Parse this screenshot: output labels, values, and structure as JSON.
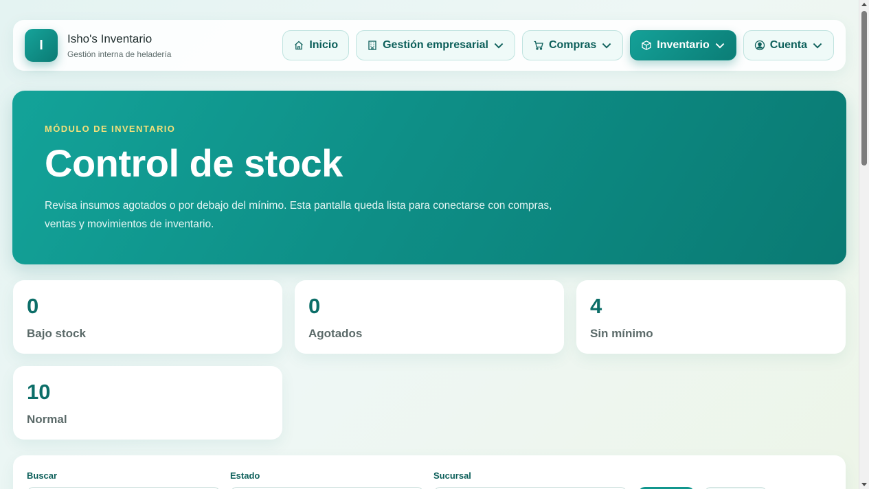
{
  "brand": {
    "logo_letter": "I",
    "title": "Isho's Inventario",
    "subtitle": "Gestión interna de heladería"
  },
  "nav": {
    "items": [
      {
        "label": "Inicio",
        "icon": "home-icon",
        "dropdown": false,
        "active": false
      },
      {
        "label": "Gestión empresarial",
        "icon": "building-icon",
        "dropdown": true,
        "active": false
      },
      {
        "label": "Compras",
        "icon": "cart-icon",
        "dropdown": true,
        "active": false
      },
      {
        "label": "Inventario",
        "icon": "box-icon",
        "dropdown": true,
        "active": true
      },
      {
        "label": "Cuenta",
        "icon": "user-circle-icon",
        "dropdown": true,
        "active": false
      }
    ]
  },
  "hero": {
    "kicker": "MÓDULO DE INVENTARIO",
    "title": "Control de stock",
    "description": "Revisa insumos agotados o por debajo del mínimo. Esta pantalla queda lista para conectarse con compras, ventas y movimientos de inventario."
  },
  "stats": [
    {
      "value": "0",
      "label": "Bajo stock"
    },
    {
      "value": "0",
      "label": "Agotados"
    },
    {
      "value": "4",
      "label": "Sin mínimo"
    },
    {
      "value": "10",
      "label": "Normal"
    }
  ],
  "filters": {
    "search_label": "Buscar",
    "status_label": "Estado",
    "branch_label": "Sucursal"
  },
  "colors": {
    "accent": "#0e8f87",
    "kicker": "#f4e07a",
    "stat_value": "#0c6e68"
  }
}
